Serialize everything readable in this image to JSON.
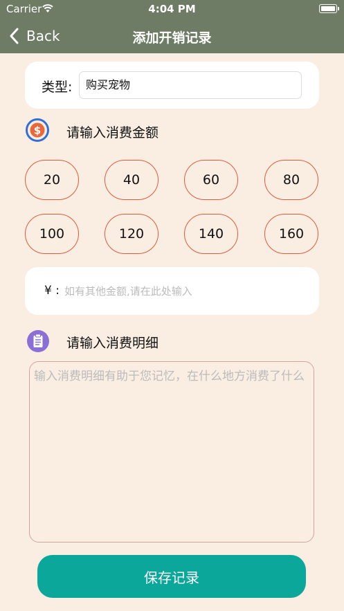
{
  "status_bar": {
    "carrier": "Carrier",
    "time": "4:04 PM"
  },
  "nav": {
    "back_label": "Back",
    "title": "添加开销记录"
  },
  "type_field": {
    "label": "类型:",
    "value": "购买宠物"
  },
  "amount_section": {
    "title": "请输入消费金额",
    "presets": [
      "20",
      "40",
      "60",
      "80",
      "100",
      "120",
      "140",
      "160"
    ],
    "currency_symbol": "¥ :",
    "custom_placeholder": "如有其他金额,请在此处输入"
  },
  "detail_section": {
    "title": "请输入消费明细",
    "placeholder": "输入消费明细有助于您记忆，在什么地方消费了什么"
  },
  "save_button": {
    "label": "保存记录"
  },
  "colors": {
    "nav_bg": "#6e7c65",
    "page_bg": "#faeee3",
    "chip_border": "#e05a3a",
    "save_bg": "#0aa79a"
  }
}
